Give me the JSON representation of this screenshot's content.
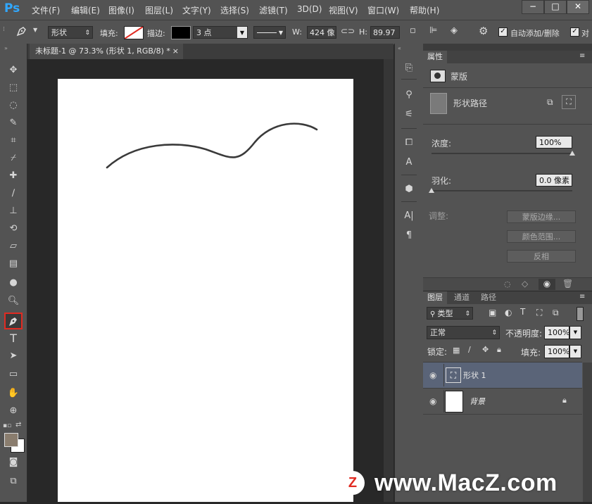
{
  "app": {
    "logo": "Ps",
    "menu": [
      "文件(F)",
      "编辑(E)",
      "图像(I)",
      "图层(L)",
      "文字(Y)",
      "选择(S)",
      "滤镜(T)",
      "3D(D)",
      "视图(V)",
      "窗口(W)",
      "帮助(H)"
    ],
    "window_controls": [
      "−",
      "□",
      "✕"
    ]
  },
  "options": {
    "mode": "形状",
    "fill_label": "填充:",
    "stroke_label": "描边:",
    "stroke_width": "3 点",
    "w_label": "W:",
    "w_value": "424 像",
    "h_label": "H:",
    "h_value": "89.97",
    "auto_add_delete": "自动添加/删除",
    "align_edges_partial": "对"
  },
  "document": {
    "tab_title": "未标题-1 @ 73.3% (形状 1, RGB/8) *",
    "tab_close": "×"
  },
  "properties": {
    "tab": "属性",
    "section": "蒙版",
    "path_label": "形状路径",
    "density_label": "浓度:",
    "density_value": "100%",
    "density_fraction": 1.0,
    "feather_label": "羽化:",
    "feather_value": "0.0 像素",
    "feather_fraction": 0.0,
    "adjust_label": "调整:",
    "btn_mask_edge": "蒙版边缘...",
    "btn_color_range": "颜色范围...",
    "btn_invert": "反相"
  },
  "layers": {
    "tabs": [
      "图层",
      "通道",
      "路径"
    ],
    "filter_kind": "类型",
    "blend_mode": "正常",
    "opacity_label": "不透明度:",
    "opacity_value": "100%",
    "lock_label": "锁定:",
    "fill_label": "填充:",
    "fill_value": "100%",
    "items": [
      {
        "name": "形状 1",
        "selected": true
      },
      {
        "name": "背景",
        "selected": false
      }
    ]
  },
  "watermark": {
    "badge": "Z",
    "text": "www.MacZ.com"
  },
  "colors": {
    "annotation_red": "#e12b22",
    "selected_layer": "#5a6478",
    "panel_bg": "#535353",
    "canvas_bg": "#282828"
  }
}
